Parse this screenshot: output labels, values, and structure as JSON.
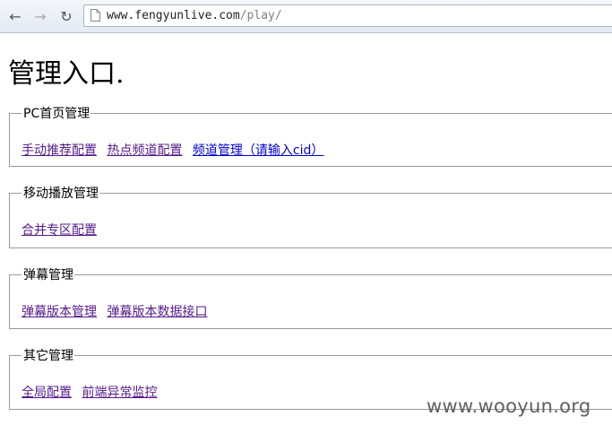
{
  "browser": {
    "url_host": "www.fengyunlive.com",
    "url_path": "/play/"
  },
  "page": {
    "title": "管理入口."
  },
  "sections": [
    {
      "legend": "PC首页管理",
      "links": [
        "手动推荐配置",
        "热点频道配置",
        "频道管理（请输入cid）"
      ]
    },
    {
      "legend": "移动播放管理",
      "links": [
        "合并专区配置"
      ]
    },
    {
      "legend": "弹幕管理",
      "links": [
        "弹幕版本管理",
        "弹幕版本数据接口"
      ]
    },
    {
      "legend": "其它管理",
      "links": [
        "全局配置",
        "前端异常监控"
      ]
    }
  ],
  "watermark": "www.wooyun.org",
  "colors": {
    "visited_link": "#551a8b",
    "unvisited_link": "#0000cc",
    "border": "#9a9a9a"
  }
}
